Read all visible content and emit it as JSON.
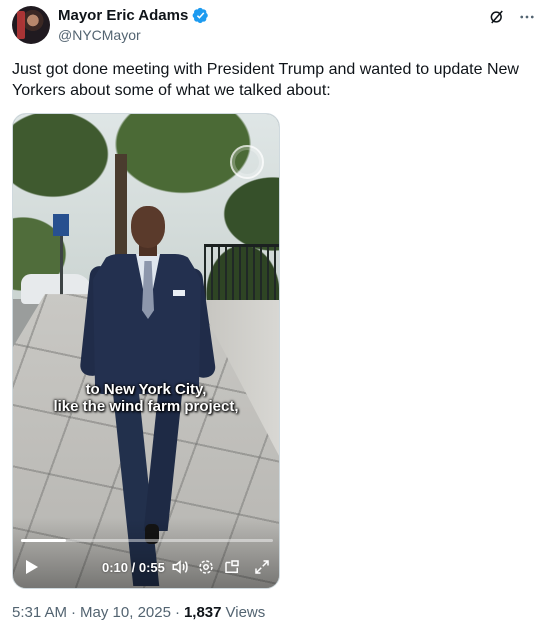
{
  "author": {
    "display_name": "Mayor Eric Adams",
    "handle": "@NYCMayor",
    "verified_color": "#1d9bf0"
  },
  "header_icons": [
    "grok-icon",
    "more-icon"
  ],
  "tweet": {
    "text": "Just got done meeting with President Trump and wanted to update New Yorkers about some of what we talked about:"
  },
  "video": {
    "caption_line1": "to New York City,",
    "caption_line2": "like the wind farm project,",
    "time": "0:10 / 0:55",
    "progress_fraction": 0.18,
    "controls": [
      "play-icon",
      "volume-icon",
      "settings-icon",
      "picture-in-picture-icon",
      "fullscreen-icon"
    ]
  },
  "meta": {
    "time": "5:31 AM",
    "separator1": "·",
    "date": "May 10, 2025",
    "separator2": "·",
    "views_count": "1,837",
    "views_label": "Views"
  }
}
